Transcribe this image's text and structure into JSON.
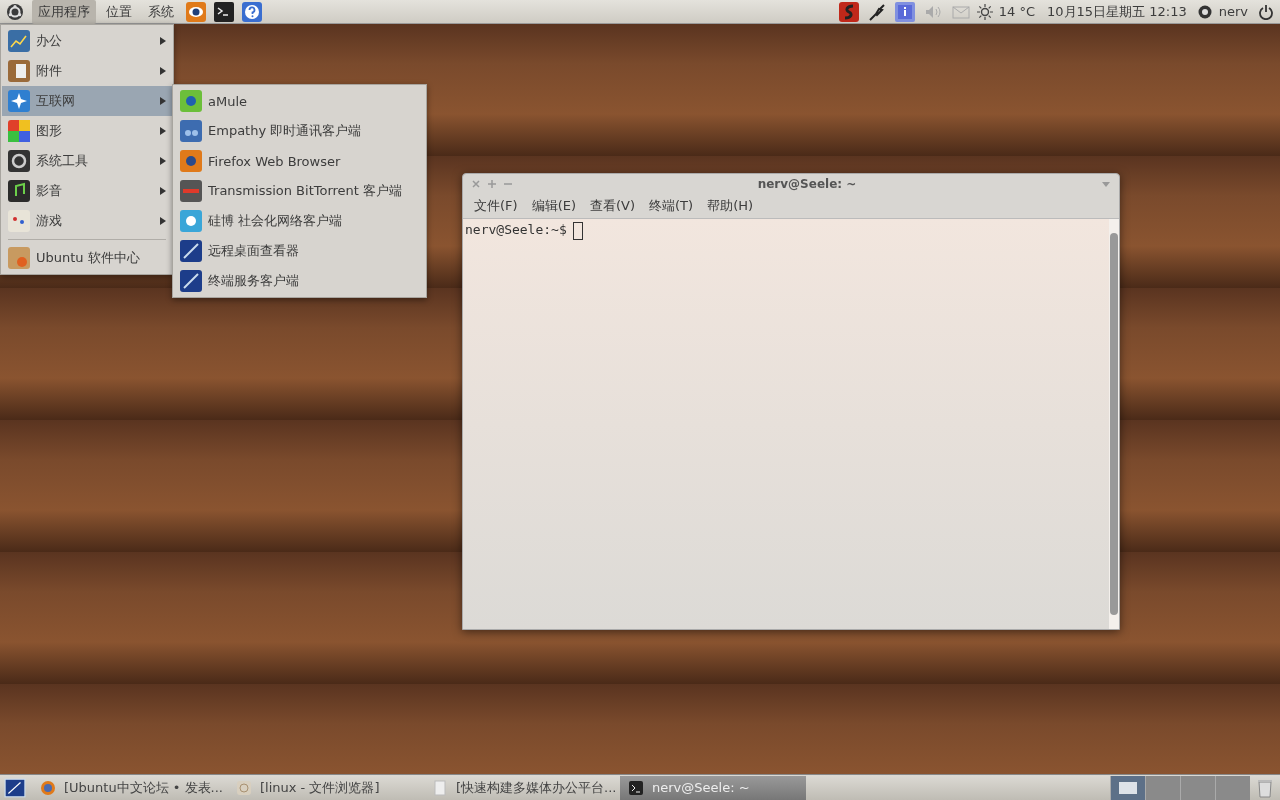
{
  "top_panel": {
    "menus": [
      {
        "label": "应用程序",
        "selected": true
      },
      {
        "label": "位置",
        "selected": false
      },
      {
        "label": "系统",
        "selected": false
      }
    ],
    "weather": "14 °C",
    "clock": "10月15日星期五 12:13",
    "user": "nerv"
  },
  "applications_menu": {
    "categories": [
      {
        "label": "办公",
        "selected": false
      },
      {
        "label": "附件",
        "selected": false
      },
      {
        "label": "互联网",
        "selected": true
      },
      {
        "label": "图形",
        "selected": false
      },
      {
        "label": "系统工具",
        "selected": false
      },
      {
        "label": "影音",
        "selected": false
      },
      {
        "label": "游戏",
        "selected": false
      }
    ],
    "footer_item": "Ubuntu 软件中心"
  },
  "internet_submenu": {
    "items": [
      "aMule",
      "Empathy 即时通讯客户端",
      "Firefox Web Browser",
      "Transmission BitTorrent 客户端",
      "硅博 社会化网络客户端",
      "远程桌面查看器",
      "终端服务客户端"
    ]
  },
  "terminal_window": {
    "title": "nerv@Seele: ~",
    "menus": [
      "文件(F)",
      "编辑(E)",
      "查看(V)",
      "终端(T)",
      "帮助(H)"
    ],
    "prompt": "nerv@Seele:~$"
  },
  "taskbar": {
    "tasks": [
      {
        "label": "[Ubuntu中文论坛 • 发表...",
        "selected": false
      },
      {
        "label": "[linux - 文件浏览器]",
        "selected": false
      },
      {
        "label": "[快速构建多媒体办公平台...",
        "selected": false
      },
      {
        "label": "nerv@Seele: ~",
        "selected": true
      }
    ],
    "workspaces": [
      {
        "selected": true
      },
      {
        "selected": false
      },
      {
        "selected": false
      },
      {
        "selected": false
      }
    ]
  }
}
